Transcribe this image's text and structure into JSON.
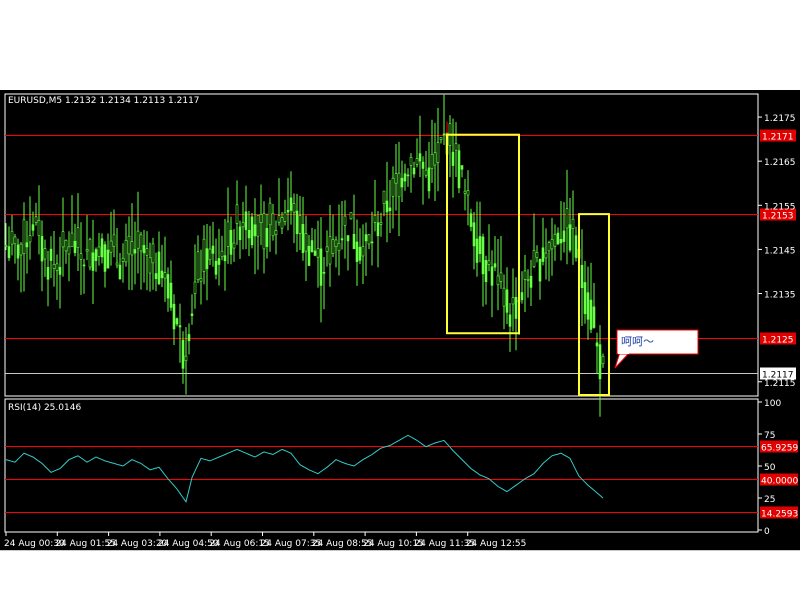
{
  "chart_data": [
    {
      "type": "candlestick",
      "title": "EURUSD,M5  1.2132 1.2134 1.2113 1.2117",
      "x_tick_labels": [
        "24 Aug 00:30",
        "24 Aug 01:55",
        "24 Aug 03:20",
        "24 Aug 04:50",
        "24 Aug 06:15",
        "24 Aug 07:35",
        "24 Aug 08:55",
        "24 Aug 10:15",
        "24 Aug 11:35",
        "24 Aug 12:55"
      ],
      "y_tick_labels": [
        "1.2175",
        "1.2165",
        "1.2155",
        "1.2145",
        "1.2135",
        "1.2115"
      ],
      "ylim": [
        1.2112,
        1.218
      ],
      "horizontal_lines": [
        {
          "label": "1.2171",
          "value": 1.2171,
          "color": "#ff0000"
        },
        {
          "label": "1.2153",
          "value": 1.2153,
          "color": "#ff0000"
        },
        {
          "label": "1.2125",
          "value": 1.2125,
          "color": "#ff0000"
        },
        {
          "label": "1.2117",
          "value": 1.2117,
          "color": "#c8c8c8"
        }
      ],
      "close_path": [
        [
          0,
          1.2146
        ],
        [
          3,
          1.2145
        ],
        [
          6,
          1.2147
        ],
        [
          9,
          1.2152
        ],
        [
          12,
          1.2145
        ],
        [
          15,
          1.2141
        ],
        [
          18,
          1.2143
        ],
        [
          21,
          1.2147
        ],
        [
          24,
          1.2145
        ],
        [
          27,
          1.2143
        ],
        [
          30,
          1.2146
        ],
        [
          33,
          1.2145
        ],
        [
          36,
          1.2144
        ],
        [
          39,
          1.2142
        ],
        [
          42,
          1.2145
        ],
        [
          45,
          1.2145
        ],
        [
          48,
          1.2141
        ],
        [
          51,
          1.2142
        ],
        [
          54,
          1.2135
        ],
        [
          57,
          1.2128
        ],
        [
          59,
          1.2122
        ],
        [
          61,
          1.2129
        ],
        [
          64,
          1.214
        ],
        [
          67,
          1.2144
        ],
        [
          70,
          1.2141
        ],
        [
          73,
          1.2146
        ],
        [
          76,
          1.2149
        ],
        [
          79,
          1.2153
        ],
        [
          82,
          1.2151
        ],
        [
          85,
          1.2148
        ],
        [
          88,
          1.2151
        ],
        [
          90,
          1.2151
        ],
        [
          93,
          1.2155
        ],
        [
          96,
          1.2153
        ],
        [
          99,
          1.2147
        ],
        [
          102,
          1.2145
        ],
        [
          105,
          1.2141
        ],
        [
          108,
          1.2145
        ],
        [
          111,
          1.2149
        ],
        [
          114,
          1.2151
        ],
        [
          117,
          1.2147
        ],
        [
          120,
          1.2145
        ],
        [
          123,
          1.215
        ],
        [
          126,
          1.2154
        ],
        [
          129,
          1.2158
        ],
        [
          132,
          1.2163
        ],
        [
          135,
          1.2166
        ],
        [
          138,
          1.2164
        ],
        [
          141,
          1.2162
        ],
        [
          144,
          1.2167
        ],
        [
          147,
          1.2171
        ],
        [
          150,
          1.2166
        ],
        [
          153,
          1.2157
        ],
        [
          156,
          1.2149
        ],
        [
          159,
          1.2143
        ],
        [
          162,
          1.214
        ],
        [
          165,
          1.2135
        ],
        [
          168,
          1.2131
        ],
        [
          171,
          1.2134
        ],
        [
          174,
          1.2139
        ],
        [
          177,
          1.2141
        ],
        [
          180,
          1.2146
        ],
        [
          183,
          1.2148
        ],
        [
          186,
          1.215
        ],
        [
          189,
          1.2148
        ],
        [
          192,
          1.2138
        ],
        [
          195,
          1.213
        ],
        [
          197,
          1.2122
        ],
        [
          199,
          1.2117
        ]
      ],
      "annotations": [
        {
          "type": "rectangle",
          "color": "#ffff33",
          "x0": 147,
          "x1": 171,
          "y0": 1.2171,
          "y1": 1.2126
        },
        {
          "type": "rectangle",
          "color": "#ffff33",
          "x0": 191,
          "x1": 201,
          "y0": 1.2153,
          "y1": 1.2112
        }
      ],
      "callout_text": "呵呵～"
    },
    {
      "type": "line",
      "title": "RSI(14)  25.0146",
      "y_tick_labels": [
        "100",
        "75",
        "50",
        "25",
        "0"
      ],
      "ylim": [
        0,
        100
      ],
      "levels": [
        {
          "label": "65.9259",
          "value": 65.9259
        },
        {
          "label": "40.0000",
          "value": 40.0
        },
        {
          "label": "14.2593",
          "value": 14.2593
        }
      ],
      "values_path": [
        [
          0,
          55
        ],
        [
          3,
          53
        ],
        [
          6,
          60
        ],
        [
          9,
          57
        ],
        [
          12,
          52
        ],
        [
          15,
          45
        ],
        [
          18,
          48
        ],
        [
          21,
          55
        ],
        [
          24,
          58
        ],
        [
          27,
          53
        ],
        [
          30,
          57
        ],
        [
          33,
          54
        ],
        [
          36,
          52
        ],
        [
          39,
          50
        ],
        [
          42,
          55
        ],
        [
          45,
          52
        ],
        [
          48,
          47
        ],
        [
          51,
          49
        ],
        [
          54,
          40
        ],
        [
          57,
          32
        ],
        [
          60,
          22
        ],
        [
          62,
          41
        ],
        [
          65,
          56
        ],
        [
          68,
          54
        ],
        [
          71,
          57
        ],
        [
          74,
          60
        ],
        [
          77,
          63
        ],
        [
          80,
          60
        ],
        [
          83,
          57
        ],
        [
          86,
          61
        ],
        [
          89,
          59
        ],
        [
          92,
          63
        ],
        [
          95,
          60
        ],
        [
          98,
          51
        ],
        [
          101,
          47
        ],
        [
          104,
          44
        ],
        [
          107,
          49
        ],
        [
          110,
          55
        ],
        [
          113,
          52
        ],
        [
          116,
          50
        ],
        [
          119,
          55
        ],
        [
          122,
          59
        ],
        [
          125,
          64
        ],
        [
          128,
          66
        ],
        [
          131,
          70
        ],
        [
          134,
          74
        ],
        [
          137,
          70
        ],
        [
          140,
          65
        ],
        [
          143,
          68
        ],
        [
          146,
          70
        ],
        [
          149,
          62
        ],
        [
          152,
          55
        ],
        [
          155,
          48
        ],
        [
          158,
          43
        ],
        [
          161,
          40
        ],
        [
          164,
          34
        ],
        [
          167,
          30
        ],
        [
          170,
          35
        ],
        [
          173,
          40
        ],
        [
          176,
          44
        ],
        [
          179,
          52
        ],
        [
          182,
          58
        ],
        [
          185,
          60
        ],
        [
          188,
          56
        ],
        [
          191,
          42
        ],
        [
          194,
          35
        ],
        [
          197,
          29
        ],
        [
          199,
          25
        ]
      ]
    }
  ]
}
